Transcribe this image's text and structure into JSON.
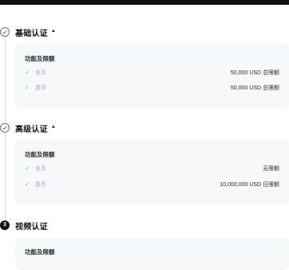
{
  "steps": [
    {
      "title": "基础认证",
      "status": "done",
      "expanded": true,
      "card_title": "功能及限额",
      "rows": [
        {
          "label": "充币",
          "value": "50,000 USD 总限额"
        },
        {
          "label": "提币",
          "value": "50,000 USD 总限额"
        }
      ]
    },
    {
      "title": "高级认证",
      "status": "done",
      "expanded": true,
      "card_title": "功能及限额",
      "rows": [
        {
          "label": "充币",
          "value": "无限额"
        },
        {
          "label": "提币",
          "value": "10,000,000 USD 日限额"
        }
      ]
    },
    {
      "title": "视频认证",
      "status": "current",
      "step_number": "3",
      "card_title": "功能及限额"
    }
  ],
  "colors": {
    "check": "#74c58f",
    "card_bg": "#f7f8f9",
    "timeline": "#cfd3d8",
    "current_marker": "#151515"
  },
  "icons": {
    "done_marker": "check-circle-icon",
    "expanded": "caret-up-icon",
    "row_check": "checkmark-icon"
  }
}
